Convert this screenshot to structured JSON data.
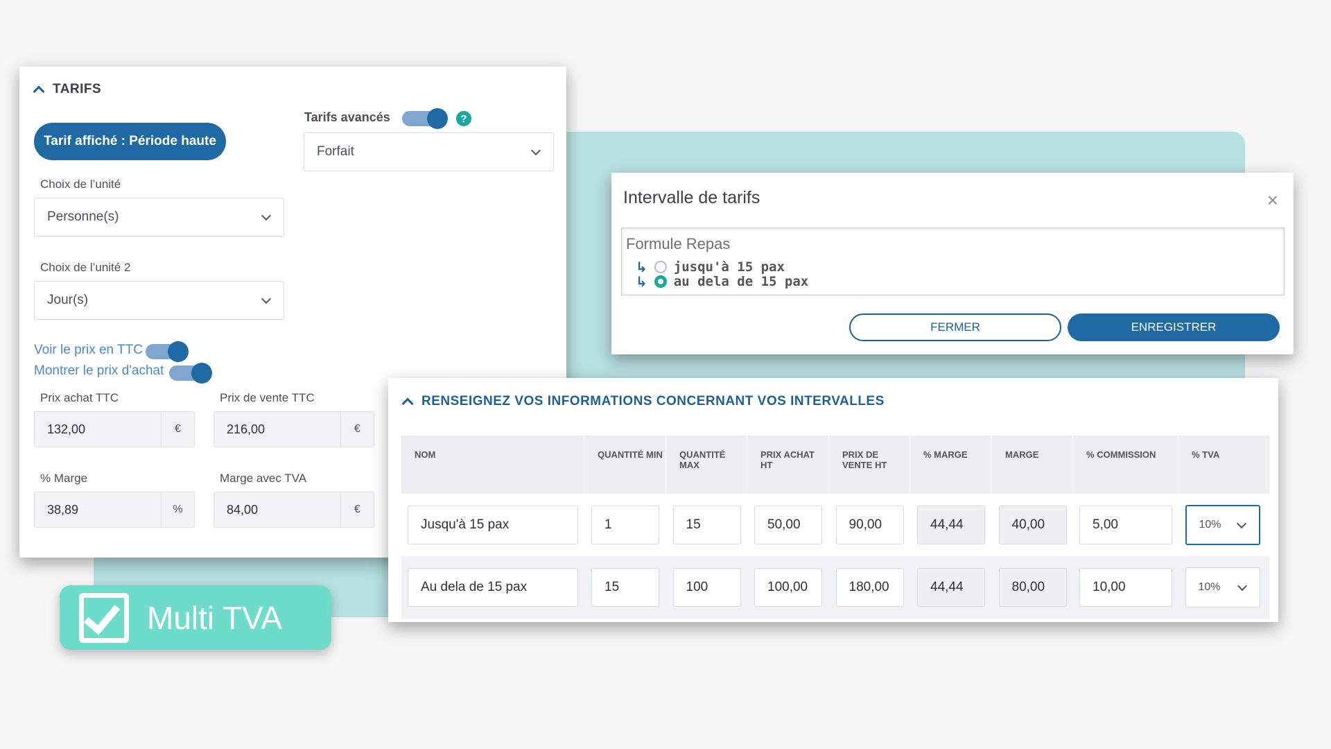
{
  "tarifs": {
    "section_title": "TARIFS",
    "tarif_button": "Tarif affiché : Période haute",
    "advanced_label": "Tarifs avancés",
    "help_icon": "?",
    "forfait_value": "Forfait",
    "unit_label": "Choix de l’unité",
    "unit_value": "Personne(s)",
    "unit2_label": "Choix de l’unité 2",
    "unit2_value": "Jour(s)",
    "toggle_ttc_label": "Voir le prix en TTC",
    "toggle_purchase_label": "Montrer le prix d'achat",
    "prix_achat_label": "Prix achat TTC",
    "prix_achat_value": "132,00",
    "prix_achat_unit": "€",
    "prix_vente_label": "Prix de vente TTC",
    "prix_vente_value": "216,00",
    "prix_vente_unit": "€",
    "marge_pct_label": "% Marge",
    "marge_pct_value": "38,89",
    "marge_pct_unit": "%",
    "marge_tva_label": "Marge avec TVA",
    "marge_tva_value": "84,00",
    "marge_tva_unit": "€"
  },
  "badge": {
    "text": "Multi TVA"
  },
  "dialog": {
    "title": "Intervalle de tarifs",
    "close": "×",
    "formula": "Formule Repas",
    "options": [
      "jusqu'à 15 pax",
      "au dela de 15 pax"
    ],
    "arrow": "↳",
    "cancel": "FERMER",
    "save": "ENREGISTRER"
  },
  "intervals": {
    "title": "RENSEIGNEZ VOS INFORMATIONS CONCERNANT VOS INTERVALLES",
    "headers": [
      "NOM",
      "QUANTITÉ MIN",
      "QUANTITÉ MAX",
      "PRIX ACHAT HT",
      "PRIX DE VENTE HT",
      "% MARGE",
      "MARGE",
      "% COMMISSION",
      "% TVA"
    ],
    "rows": [
      [
        "Jusqu'à 15 pax",
        "1",
        "15",
        "50,00",
        "90,00",
        "44,44",
        "40,00",
        "5,00",
        "10%"
      ],
      [
        "Au dela de 15 pax",
        "15",
        "100",
        "100,00",
        "180,00",
        "44,44",
        "80,00",
        "10,00",
        "10%"
      ]
    ]
  }
}
